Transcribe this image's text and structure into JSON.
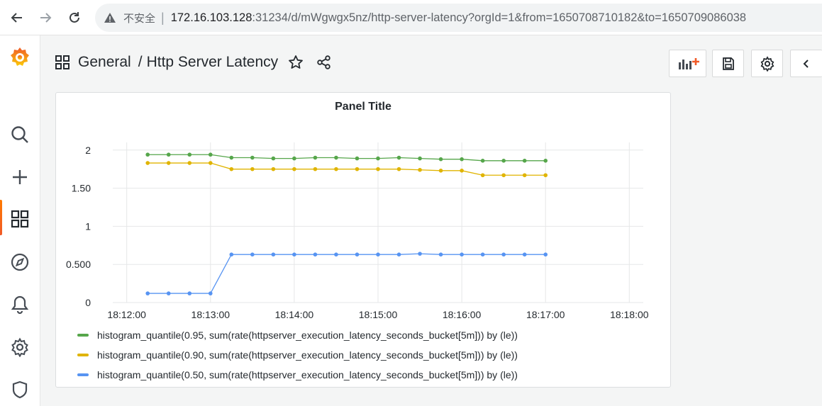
{
  "browser": {
    "insecure_label": "不安全",
    "url_host": "172.16.103.128",
    "url_rest": ":31234/d/mWgwgx5nz/http-server-latency?orgId=1&from=1650708710182&to=1650709086038"
  },
  "sidebar": {
    "items": [
      {
        "name": "grafana-logo",
        "icon": "grafana-logo"
      },
      {
        "name": "search",
        "icon": "search-icon"
      },
      {
        "name": "create",
        "icon": "plus-icon"
      },
      {
        "name": "dashboards",
        "icon": "dashboards-icon",
        "active": true
      },
      {
        "name": "explore",
        "icon": "compass-icon"
      },
      {
        "name": "alerting",
        "icon": "bell-icon"
      },
      {
        "name": "configuration",
        "icon": "gear-icon"
      },
      {
        "name": "server-admin",
        "icon": "shield-icon"
      }
    ]
  },
  "header": {
    "folder": "General",
    "separator": "/",
    "dashboard_title": "Http Server Latency",
    "buttons": [
      "add-panel-icon",
      "save-icon",
      "settings-icon",
      "chevron-left-icon"
    ]
  },
  "panel": {
    "title": "Panel Title"
  },
  "colors": {
    "green": "#56a64b",
    "yellow": "#e0b400",
    "blue": "#5794f2",
    "accent": "#f05a28"
  },
  "chart_data": {
    "type": "line",
    "title": "Panel Title",
    "x_tick_labels": [
      "18:12:00",
      "18:13:00",
      "18:14:00",
      "18:15:00",
      "18:16:00",
      "18:17:00",
      "18:18:00"
    ],
    "y_tick_labels": [
      "0",
      "0.500",
      "1",
      "1.50",
      "2"
    ],
    "ylim": [
      0,
      2.1
    ],
    "xlim": [
      "18:11:50",
      "18:18:10"
    ],
    "grid": true,
    "legend_position": "bottom",
    "x": [
      "18:12:15",
      "18:12:30",
      "18:12:45",
      "18:13:00",
      "18:13:15",
      "18:13:30",
      "18:13:45",
      "18:14:00",
      "18:14:15",
      "18:14:30",
      "18:14:45",
      "18:15:00",
      "18:15:15",
      "18:15:30",
      "18:15:45",
      "18:16:00",
      "18:16:15",
      "18:16:30",
      "18:16:45",
      "18:17:00"
    ],
    "series": [
      {
        "name": "histogram_quantile(0.95, sum(rate(httpserver_execution_latency_seconds_bucket[5m])) by (le))",
        "color": "#56a64b",
        "values": [
          1.94,
          1.94,
          1.94,
          1.94,
          1.9,
          1.9,
          1.89,
          1.89,
          1.9,
          1.9,
          1.89,
          1.89,
          1.9,
          1.89,
          1.88,
          1.88,
          1.86,
          1.86,
          1.86,
          1.86
        ]
      },
      {
        "name": "histogram_quantile(0.90, sum(rate(httpserver_execution_latency_seconds_bucket[5m])) by (le))",
        "color": "#e0b400",
        "values": [
          1.83,
          1.83,
          1.83,
          1.83,
          1.75,
          1.75,
          1.75,
          1.75,
          1.75,
          1.75,
          1.75,
          1.75,
          1.75,
          1.74,
          1.73,
          1.73,
          1.67,
          1.67,
          1.67,
          1.67
        ]
      },
      {
        "name": "histogram_quantile(0.50, sum(rate(httpserver_execution_latency_seconds_bucket[5m])) by (le))",
        "color": "#5794f2",
        "values": [
          0.12,
          0.12,
          0.12,
          0.12,
          0.63,
          0.63,
          0.63,
          0.63,
          0.63,
          0.63,
          0.63,
          0.63,
          0.63,
          0.64,
          0.63,
          0.63,
          0.63,
          0.63,
          0.63,
          0.63
        ]
      }
    ]
  }
}
